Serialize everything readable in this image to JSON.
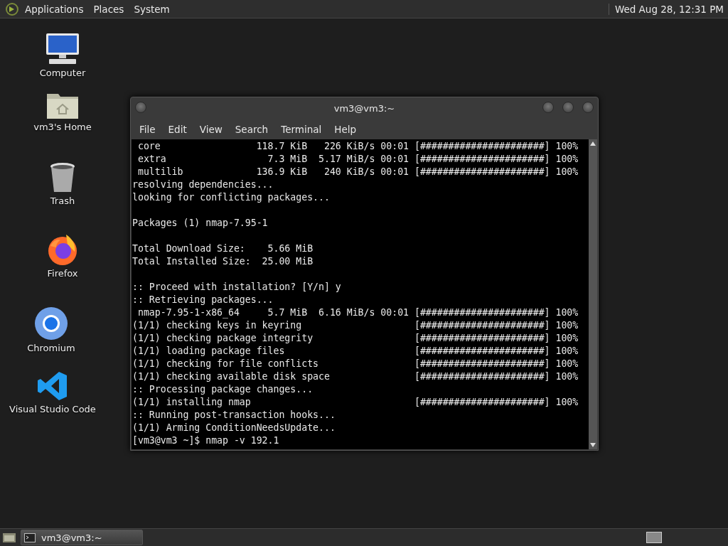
{
  "top_panel": {
    "menus": [
      "Applications",
      "Places",
      "System"
    ],
    "clock": "Wed Aug 28, 12:31 PM"
  },
  "desktop_icons": [
    {
      "kind": "computer",
      "label": "Computer"
    },
    {
      "kind": "home",
      "label": "vm3's Home"
    },
    {
      "kind": "trash",
      "label": "Trash"
    },
    {
      "kind": "firefox",
      "label": "Firefox"
    },
    {
      "kind": "chromium",
      "label": "Chromium"
    },
    {
      "kind": "vscode",
      "label": "Visual Studio Code"
    }
  ],
  "terminal": {
    "title": "vm3@vm3:~",
    "menu": [
      "File",
      "Edit",
      "View",
      "Search",
      "Terminal",
      "Help"
    ],
    "blocks": [
      {
        "lines": [
          " core                 118.7 KiB   226 KiB/s 00:01 [######################] 100%",
          " extra                  7.3 MiB  5.17 MiB/s 00:01 [######################] 100%",
          " multilib             136.9 KiB   240 KiB/s 00:01 [######################] 100%",
          "resolving dependencies...",
          "looking for conflicting packages..."
        ]
      },
      {
        "lines": [
          "Packages (1) nmap-7.95-1"
        ]
      },
      {
        "lines": [
          "Total Download Size:    5.66 MiB",
          "Total Installed Size:  25.00 MiB"
        ]
      },
      {
        "lines": [
          ":: Proceed with installation? [Y/n] y",
          ":: Retrieving packages...",
          " nmap-7.95-1-x86_64     5.7 MiB  6.16 MiB/s 00:01 [######################] 100%",
          "(1/1) checking keys in keyring                    [######################] 100%",
          "(1/1) checking package integrity                  [######################] 100%",
          "(1/1) loading package files                       [######################] 100%",
          "(1/1) checking for file conflicts                 [######################] 100%",
          "(1/1) checking available disk space               [######################] 100%",
          ":: Processing package changes...",
          "(1/1) installing nmap                             [######################] 100%",
          ":: Running post-transaction hooks...",
          "(1/1) Arming ConditionNeedsUpdate...",
          "[vm3@vm3 ~]$ nmap -v 192.1"
        ]
      }
    ]
  },
  "taskbar": {
    "tasks": [
      {
        "label": "vm3@vm3:~",
        "selected": true
      }
    ]
  }
}
